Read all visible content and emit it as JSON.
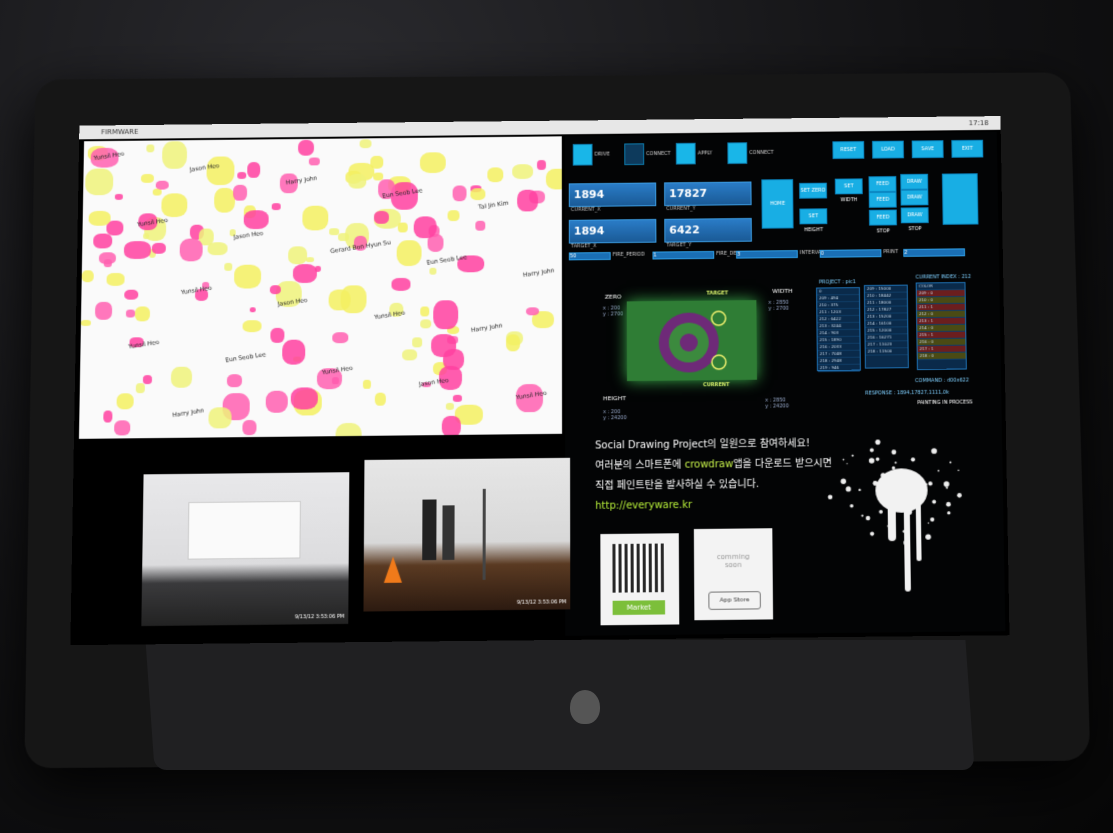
{
  "menubar": {
    "app_name": "FIRMWARE",
    "clock": "17:18"
  },
  "drawing": {
    "names": [
      "Yunsil Heo",
      "Jason Heo",
      "Harry John",
      "Eun Seob Lee",
      "Tal Jin Kim",
      "Yunsil Heo",
      "Jason Heo",
      "Gerard Bon Hyun Su",
      "Eun Seob Lee",
      "Harry John",
      "Yunsil Heo",
      "Jason Heo",
      "Yunsil Heo",
      "Harry John",
      "Yunsil Heo",
      "Eun Seob Lee",
      "Yunsil Heo",
      "Jason Heo",
      "Yunsil Heo",
      "Harry John"
    ]
  },
  "control": {
    "checks": [
      {
        "label": "DRIVE",
        "color": "#19b6e8"
      },
      {
        "label": "CONNECT",
        "color": "#0d3a5c"
      },
      {
        "label": "APPLY",
        "color": "#19b6e8"
      },
      {
        "label": "CONNECT",
        "color": "#19b6e8"
      }
    ],
    "top_buttons": [
      "RESET",
      "LOAD",
      "SAVE",
      "EXIT"
    ],
    "fields": [
      {
        "value": "1894",
        "label": "CURRENT_X"
      },
      {
        "value": "17827",
        "label": "CURRENT_Y"
      },
      {
        "value": "1894",
        "label": "TARGET_X"
      },
      {
        "value": "6422",
        "label": "TARGET_Y"
      }
    ],
    "move_buttons": [
      "HOME",
      "SET ZERO",
      "SET WIDTH",
      "FEED LEFT",
      "DRAW LEFT",
      "SET HEIGHT",
      "FEED RIGHT",
      "DRAW RIGHT",
      "FEED STOP",
      "DRAW STOP"
    ],
    "sliders": [
      {
        "value": "50",
        "label": "FIRE_PERIOD"
      },
      {
        "value": "1",
        "label": "FIRE_DELAY"
      },
      {
        "value": "3",
        "label": "INTERVAL"
      },
      {
        "value": "0",
        "label": "PRINT"
      },
      {
        "value": "2",
        "label": ""
      }
    ],
    "canvas": {
      "zero_label": "ZERO",
      "zero_coords": "x : 200\ny : 2700",
      "width_label": "WIDTH",
      "width_coords": "x : 2850\ny : 2700",
      "height_label": "HEIGHT",
      "height_coords": "x : 200\ny : 24200",
      "end_coords": "x : 2850\ny : 24200",
      "target_label": "TARGET",
      "current_label": "CURRENT"
    },
    "project": {
      "label": "PROJECT : pic1",
      "index_label": "CURRENT INDEX : 212"
    },
    "list_a": [
      "0",
      "209 : 494",
      "210 : 375",
      "211 : 1203",
      "212 : 6422",
      "213 : 3244",
      "214 : 903",
      "215 : 1890",
      "216 : 2033",
      "217 : 7048",
      "218 : 2948",
      "219 : 946"
    ],
    "list_b": [
      "209 : 15000",
      "210 : 18442",
      "211 : 18000",
      "212 : 17827",
      "213 : 15200",
      "214 : 16100",
      "215 : 12000",
      "216 : 16271",
      "217 : 11023",
      "218 : 11500"
    ],
    "list_c": [
      "COLOR",
      "209 : 0",
      "210 : 0",
      "211 : 1",
      "212 : 0",
      "213 : 1",
      "214 : 0",
      "215 : 1",
      "216 : 0",
      "217 : 1",
      "218 : 0"
    ],
    "command": "COMMAND : d00x622",
    "response": "RESPONSE : 1894,17827,1111,0k",
    "status": "PAINTING IN PROCESS"
  },
  "promo": {
    "line1": "Social Drawing Project의 일원으로 참여하세요!",
    "line2a": "여러분의 스마트폰에 ",
    "line2b": "crowdraw",
    "line2c": "앱을 다운로드 받으시면",
    "line3": "직접 페인트탄을 발사하실 수 있습니다.",
    "url": "http://everyware.kr",
    "market_label": "Market",
    "coming_soon": "comming\nsoon",
    "app_store": "App Store",
    "app_store_small": "Available on the"
  },
  "cams": [
    {
      "timestamp": "9/13/12 3:53:06 PM"
    },
    {
      "timestamp": "9/13/12 3:53:06 PM"
    }
  ]
}
